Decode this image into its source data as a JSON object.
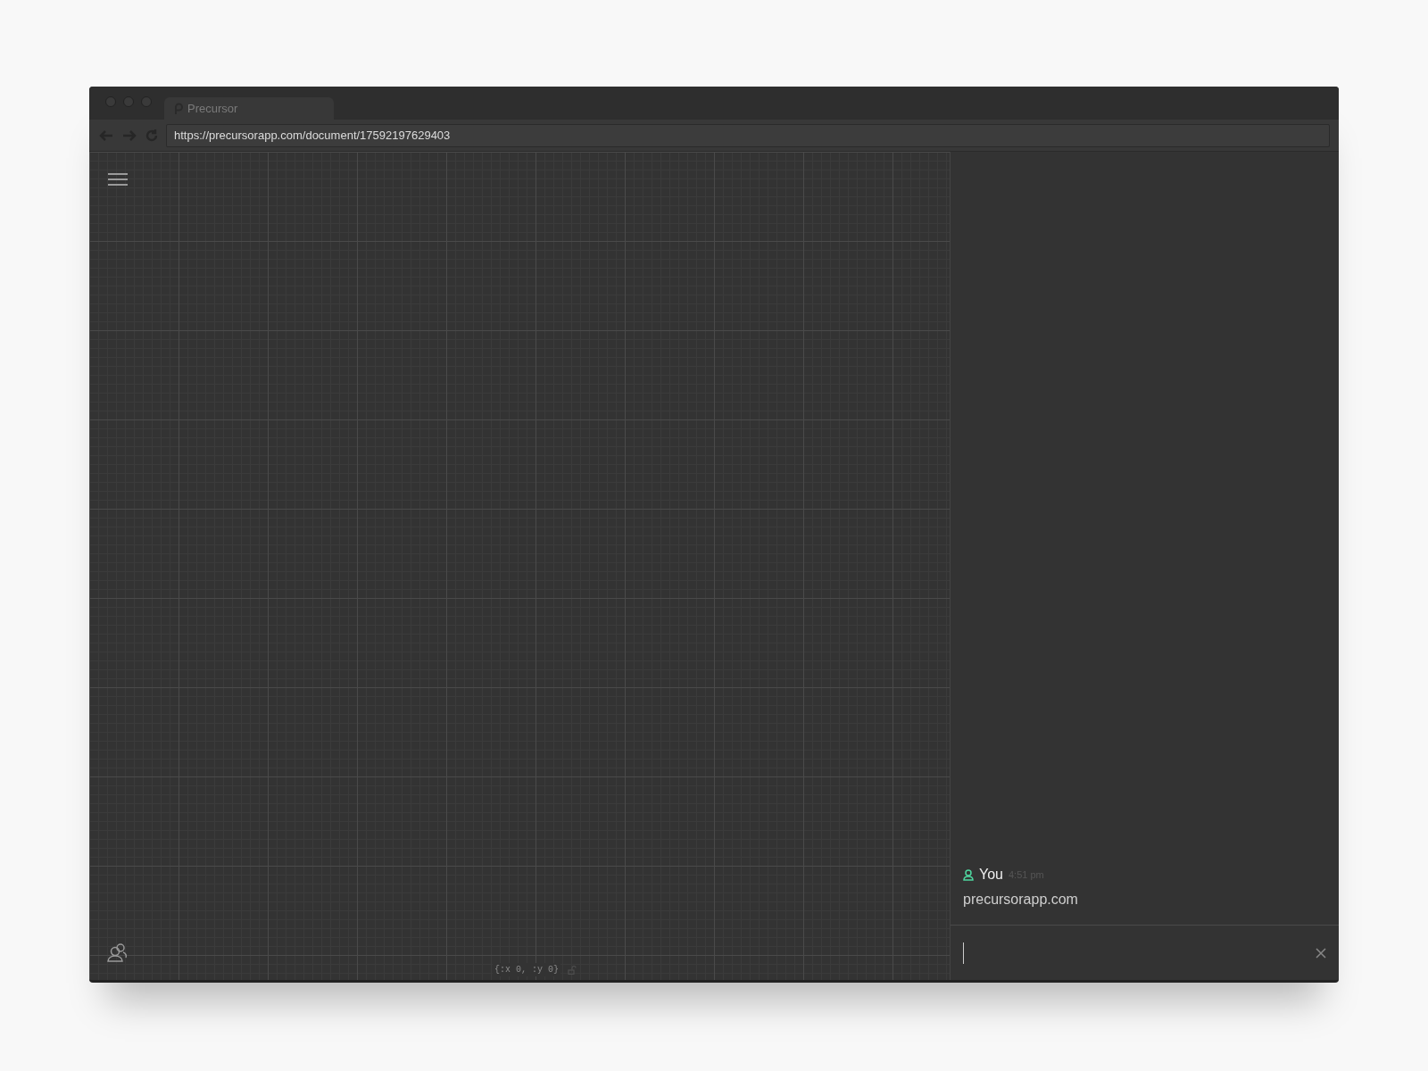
{
  "browser": {
    "tab_title": "Precursor",
    "url": "https://precursorapp.com/document/17592197629403"
  },
  "canvas": {
    "coordinates": "{:x 0, :y 0}"
  },
  "chat": {
    "messages": [
      {
        "author": "You",
        "time": "4:51 pm",
        "text": "precursorapp.com"
      }
    ]
  }
}
